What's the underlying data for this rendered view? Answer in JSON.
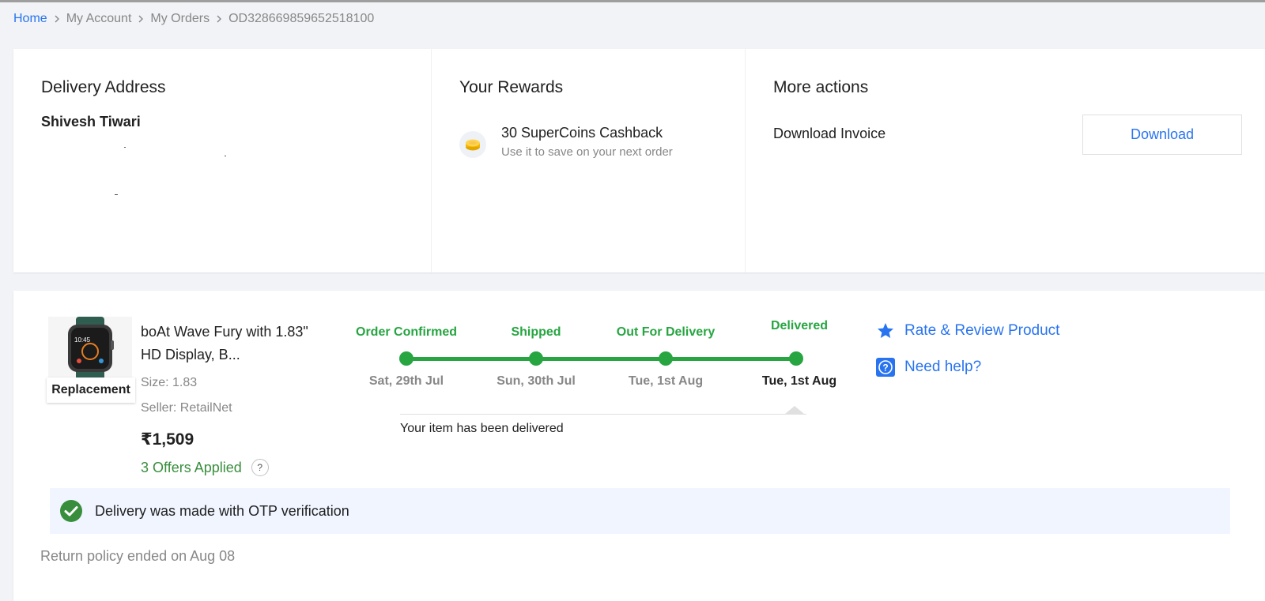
{
  "breadcrumb": [
    {
      "label": "Home"
    },
    {
      "label": "My Account"
    },
    {
      "label": "My Orders"
    },
    {
      "label": "OD328669859652518100"
    }
  ],
  "delivery_address": {
    "heading": "Delivery Address",
    "name": "Shivesh Tiwari"
  },
  "rewards": {
    "heading": "Your Rewards",
    "title": "30 SuperCoins Cashback",
    "subtitle": "Use it to save on your next order",
    "icon": "supercoin-icon"
  },
  "more_actions": {
    "heading": "More actions",
    "invoice_label": "Download Invoice",
    "download_label": "Download"
  },
  "product": {
    "title": "boAt Wave Fury with 1.83\" HD Display, B...",
    "size": "Size: 1.83",
    "seller": "Seller: RetailNet",
    "price": "₹1,509",
    "offers": "3 Offers Applied",
    "offers_help": "?",
    "badge": "Replacement"
  },
  "tracker": {
    "steps": [
      {
        "label": "Order Confirmed",
        "date": "Sat, 29th Jul"
      },
      {
        "label": "Shipped",
        "date": "Sun, 30th Jul"
      },
      {
        "label": "Out For Delivery",
        "date": "Tue, 1st Aug"
      },
      {
        "label": "Delivered",
        "date": "Tue, 1st Aug"
      }
    ],
    "message": "Your item has been delivered",
    "color": "#26a541"
  },
  "actions": {
    "rate_review": "Rate & Review Product",
    "need_help": "Need help?"
  },
  "otp": {
    "text": "Delivery was made with OTP verification"
  },
  "return_policy": "Return policy ended on Aug 08",
  "colors": {
    "accent": "#2874f0",
    "success": "#388e3c",
    "muted": "#878787"
  }
}
